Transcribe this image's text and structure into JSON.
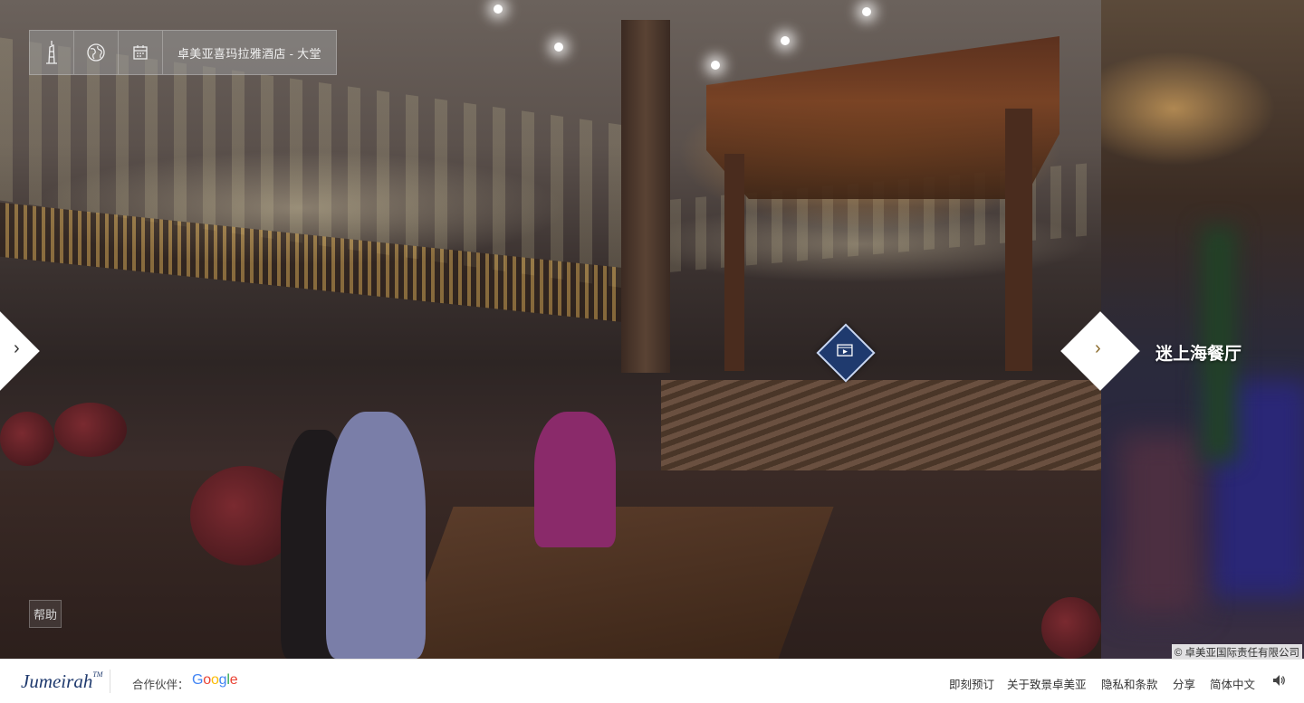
{
  "toolbar": {
    "icons": [
      "tower-icon",
      "globe-icon",
      "calendar-icon"
    ],
    "title": "卓美亚喜玛拉雅酒店 - 大堂"
  },
  "navigation": {
    "prev_chevron": "›",
    "next_chevron": "›",
    "next_label": "迷上海餐厅"
  },
  "hotspot": {
    "icon": "video-icon"
  },
  "help_label": "帮助",
  "copyright": "© 卓美亚国际责任有限公司",
  "footer": {
    "brand": "Jumeirah",
    "brand_tm": "TM",
    "partner_label": "合作伙伴：",
    "google_letters": [
      {
        "ch": "G",
        "color": "#4285F4"
      },
      {
        "ch": "o",
        "color": "#EA4335"
      },
      {
        "ch": "o",
        "color": "#FBBC05"
      },
      {
        "ch": "g",
        "color": "#4285F4"
      },
      {
        "ch": "l",
        "color": "#34A853"
      },
      {
        "ch": "e",
        "color": "#EA4335"
      }
    ],
    "links": [
      "即刻预订",
      "关于致景卓美亚",
      "隐私和条款",
      "分享",
      "简体中文"
    ],
    "sound_icon": "speaker-icon"
  },
  "colors": {
    "brand_blue": "#1f3a6e",
    "accent_gold": "#8a6a2a"
  }
}
